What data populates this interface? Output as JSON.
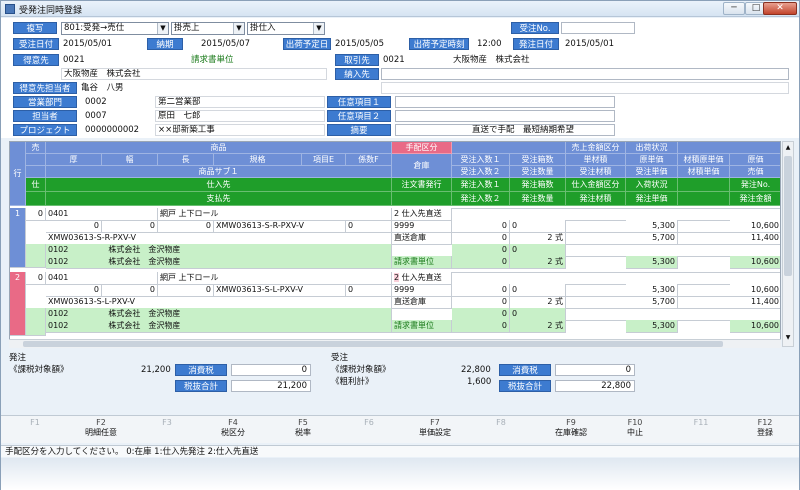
{
  "window": {
    "title": "受発注同時登録",
    "min": "─",
    "max": "□",
    "close": "✕"
  },
  "header": {
    "copy_btn": "複写",
    "type_select": "801:受発→売仕",
    "sale_select": "掛売上",
    "purchase_select": "掛仕入",
    "order_no_label": "受注No.",
    "order_no_value": "",
    "order_date_label": "受注日付",
    "order_date": "2015/05/01",
    "deadline_label": "納期",
    "deadline": "2015/05/07",
    "ship_date_label": "出荷予定日",
    "ship_date": "2015/05/05",
    "ship_time_label": "出荷予定時刻",
    "ship_time": "12:00",
    "issue_date_label": "発注日付",
    "issue_date": "2015/05/01",
    "customer_label": "得意先",
    "customer_code": "0021",
    "customer_name": "大阪物産　株式会社",
    "billing_unit": "請求書単位",
    "supplier_label": "取引先",
    "supplier_code": "0021",
    "supplier_name": "大阪物産　株式会社",
    "delivery_label": "納入先",
    "delivery_value": "",
    "rep_label": "得意先担当者",
    "rep_value": "亀谷　八男",
    "sales_dept_label": "営業部門",
    "sales_dept_code": "0002",
    "sales_dept_name": "第二営業部",
    "staff_label": "担当者",
    "staff_code": "0007",
    "staff_name": "原田　七郎",
    "project_label": "プロジェクト",
    "project_code": "0000000002",
    "project_name": "××邸新築工事",
    "opt1_label": "任意項目１",
    "opt1_value": "",
    "opt2_label": "任意項目２",
    "opt2_value": "",
    "memo_label": "摘要",
    "memo_value": "直送で手配　最短納期希望"
  },
  "grid": {
    "hdr_row": "行",
    "hdr_class": "売",
    "hdr_product": "商品",
    "hdr_arrange": "手配区分",
    "hdr_sale_amt": "売上金額区分",
    "hdr_ship": "出荷状況",
    "hdr_thick": "厚",
    "hdr_width": "幅",
    "hdr_length": "長",
    "hdr_spec": "規格",
    "hdr_itemE": "項目E",
    "hdr_coef": "係数F",
    "hdr_warehouse": "倉庫",
    "hdr_in_qty1": "受注入数１",
    "hdr_box_qty": "受注箱数",
    "hdr_unit_vol": "単材積",
    "hdr_cost_price": "原単価",
    "hdr_mat_cost": "材積原単価",
    "hdr_cost": "原価",
    "hdr_sub1": "商品サブ１",
    "hdr_in_qty2": "受注入数２",
    "hdr_qty": "受注数量",
    "hdr_vol": "受注材積",
    "hdr_unit_price": "受注単価",
    "hdr_mat_price": "材積単価",
    "hdr_sell_price": "売価",
    "hdr_purchase": "仕",
    "hdr_vendor": "仕入先",
    "hdr_order_issue": "注文書発行",
    "hdr_po_in_qty": "発注入数１",
    "hdr_po_box": "発注箱数",
    "hdr_po_amt_cls": "仕入金額区分",
    "hdr_arrival": "入荷状況",
    "hdr_po_no": "発注No.",
    "hdr_payee": "支払先",
    "hdr_po_in_qty2": "発注入数２",
    "hdr_po_qty": "発注数量",
    "hdr_po_vol": "発注材積",
    "hdr_po_price": "発注単価",
    "hdr_po_amount": "発注金額",
    "rows": [
      {
        "no": "1",
        "cls": "0",
        "code": "0401",
        "name": "網戸 上下ロール",
        "arrange": "2",
        "arrange_name": "仕入先直送",
        "t": "0",
        "w": "0",
        "l": "0",
        "spec": "XMW03613-S-R-PXV-V",
        "f": "0",
        "wh": "9999",
        "qty": "0",
        "box": "0",
        "cost_price": "5,300",
        "cost": "10,600",
        "sub1": "XMW03613-S-R-PXV-V",
        "wh_name": "直送倉庫",
        "box2": "0",
        "qty2": "2",
        "unit": "式",
        "unit_price": "5,700",
        "sell": "11,400",
        "vendor_code": "0102",
        "vendor_name": "株式会社　金沢物産",
        "pin": "0",
        "pbox": "0",
        "payee_code": "0102",
        "payee_name": "株式会社　金沢物産",
        "order_unit": "請求書単位",
        "pq": "0",
        "pqty": "2",
        "punit": "式",
        "pprice": "5,300",
        "pamount": "10,600"
      },
      {
        "no": "2",
        "cls": "0",
        "code": "0401",
        "name": "網戸 上下ロール",
        "arrange": "2",
        "arrange_name": "仕入先直送",
        "t": "0",
        "w": "0",
        "l": "0",
        "spec": "XMW03613-S-L-PXV-V",
        "f": "0",
        "wh": "9999",
        "qty": "0",
        "box": "0",
        "cost_price": "5,300",
        "cost": "10,600",
        "sub1": "XMW03613-S-L-PXV-V",
        "wh_name": "直送倉庫",
        "box2": "0",
        "qty2": "2",
        "unit": "式",
        "unit_price": "5,700",
        "sell": "11,400",
        "vendor_code": "0102",
        "vendor_name": "株式会社　金沢物産",
        "pin": "0",
        "pbox": "0",
        "payee_code": "0102",
        "payee_name": "株式会社　金沢物産",
        "order_unit": "請求書単位",
        "pq": "0",
        "pqty": "2",
        "punit": "式",
        "pprice": "5,300",
        "pamount": "10,600"
      }
    ]
  },
  "totals": {
    "po_title": "発注",
    "po_taxable_label": "《課税対象額》",
    "po_taxable": "21,200",
    "po_tax_label": "消費税",
    "po_tax": "0",
    "po_total_label": "税抜合計",
    "po_total": "21,200",
    "so_title": "受注",
    "so_taxable_label": "《課税対象額》",
    "so_taxable": "22,800",
    "so_profit_label": "《粗利計》",
    "so_profit": "1,600",
    "so_tax_label": "消費税",
    "so_tax": "0",
    "so_total_label": "税抜合計",
    "so_total": "22,800"
  },
  "fkeys": [
    {
      "n": "F1",
      "t": ""
    },
    {
      "n": "F2",
      "t": "明細任意"
    },
    {
      "n": "F3",
      "t": ""
    },
    {
      "n": "F4",
      "t": "税区分"
    },
    {
      "n": "F5",
      "t": "税率"
    },
    {
      "n": "F6",
      "t": ""
    },
    {
      "n": "F7",
      "t": "単価設定"
    },
    {
      "n": "F8",
      "t": ""
    },
    {
      "n": "F9",
      "t": "在庫確認"
    },
    {
      "n": "F10",
      "t": "中止"
    },
    {
      "n": "F11",
      "t": ""
    },
    {
      "n": "F12",
      "t": "登録"
    }
  ],
  "status": "手配区分を入力してください。 0:在庫 1:仕入先発注 2:仕入先直送",
  "colors": {
    "blue": "#3d7bd0",
    "header_blue": "#6e8fd6",
    "header_green": "#1f9e2a",
    "pink": "#e96a86",
    "row_green": "#c8f0c8"
  }
}
